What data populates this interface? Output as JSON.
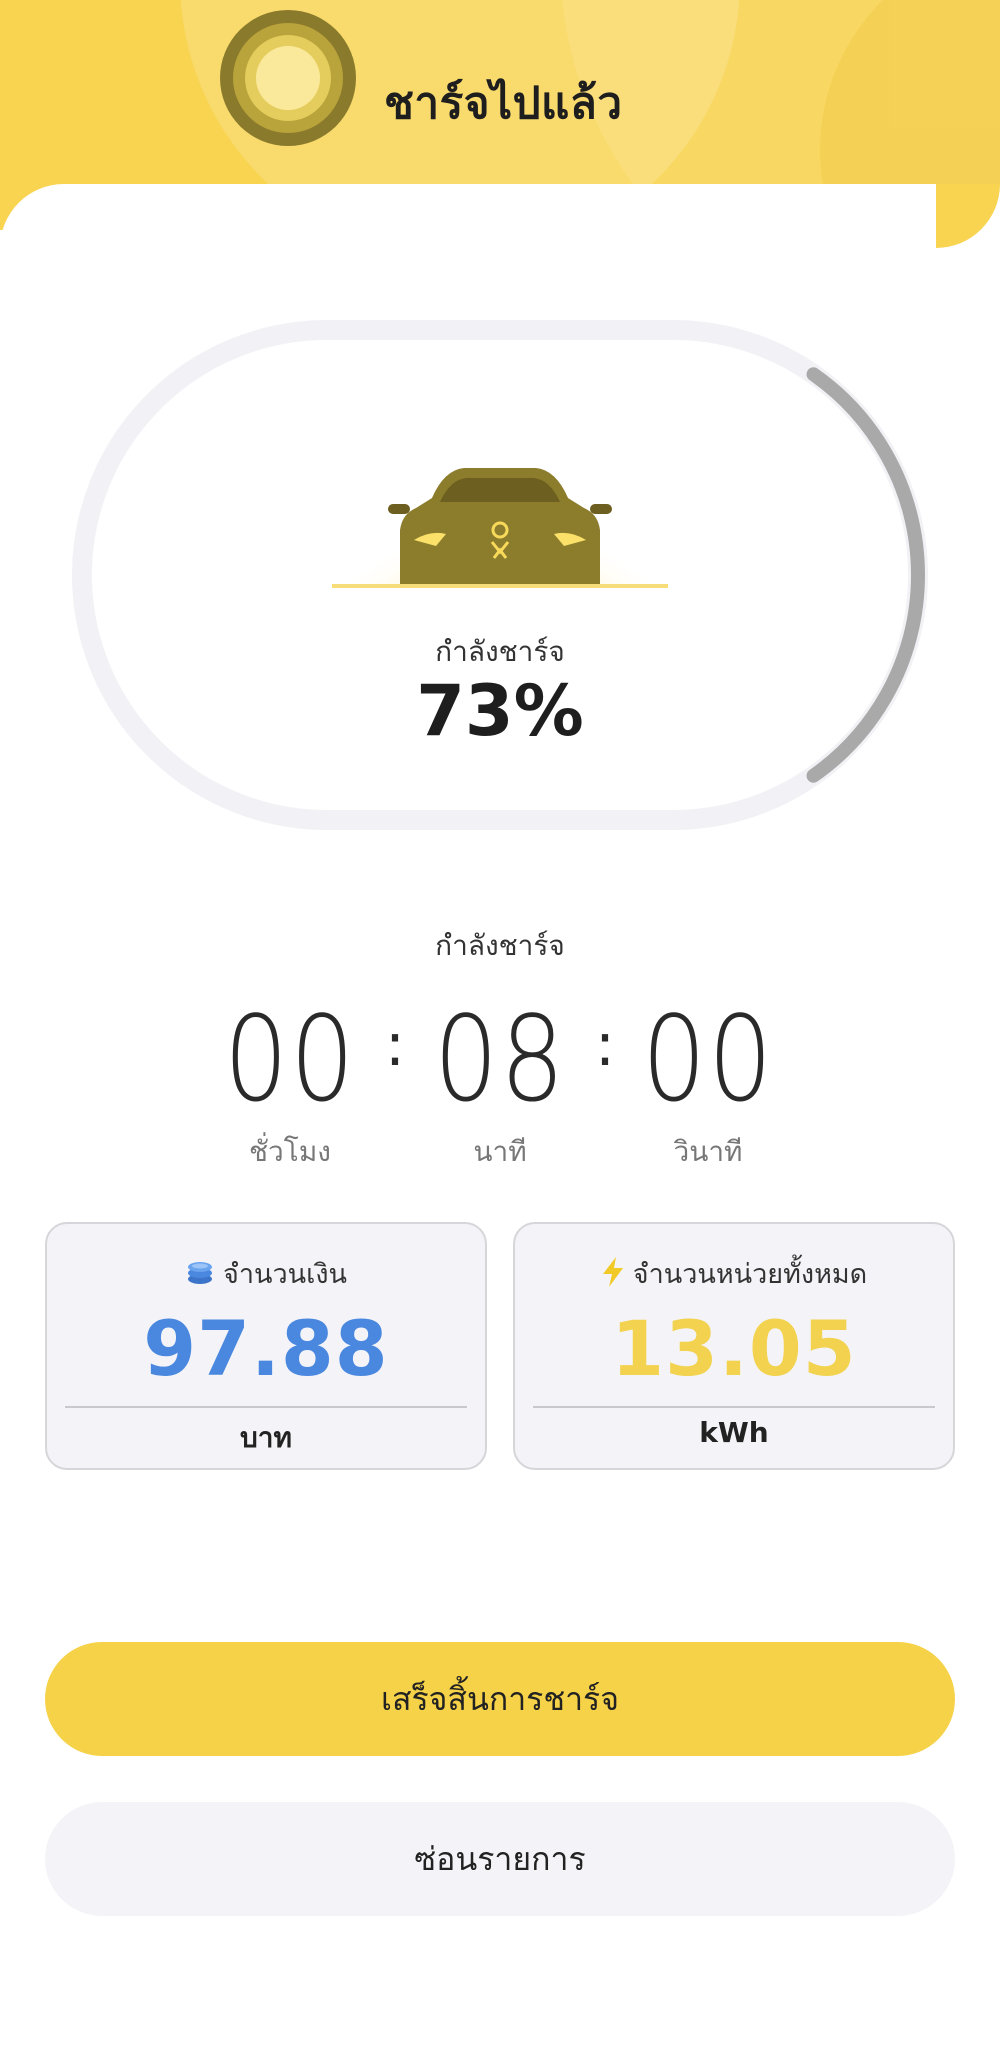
{
  "header": {
    "title": "ชาร์จไปแล้ว",
    "status_icon": "charging-sun-icon"
  },
  "progress": {
    "label": "กำลังชาร์จ",
    "percent_text": "73%",
    "percent_value": 73,
    "car_icon": "car-icon"
  },
  "timer": {
    "label": "กำลังชาร์จ",
    "hours": "00",
    "minutes": "08",
    "seconds": "00",
    "hours_unit": "ชั่วโมง",
    "minutes_unit": "นาที",
    "seconds_unit": "วินาที"
  },
  "stats": {
    "money": {
      "icon": "coins-icon",
      "title": "จำนวนเงิน",
      "value": "97.88",
      "unit": "บาท",
      "color": "#4a88e0"
    },
    "energy": {
      "icon": "lightning-icon",
      "title": "จำนวนหน่วยทั้งหมด",
      "value": "13.05",
      "unit": "kWh",
      "color": "#f2d24e"
    }
  },
  "actions": {
    "finish_label": "เสร็จสิ้นการชาร์จ",
    "hide_label": "ซ่อนรายการ"
  },
  "colors": {
    "brand_yellow": "#f8d451",
    "button_yellow": "#f6d248",
    "progress_gray": "#a9a9a9",
    "track_gray": "#f2f2f6"
  }
}
